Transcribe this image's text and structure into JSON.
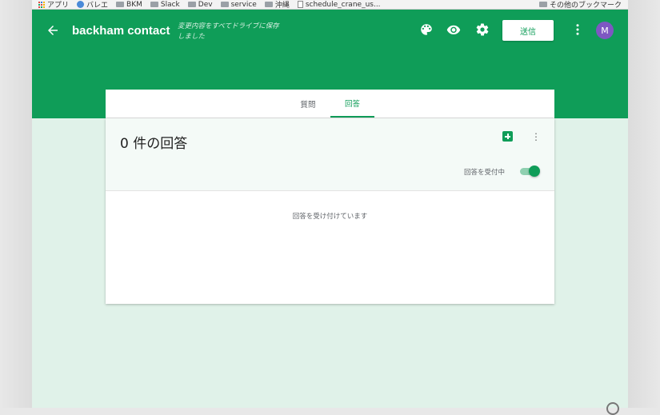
{
  "bookmarks": {
    "items": [
      "アプリ",
      "バレエ",
      "BKM",
      "Slack",
      "Dev",
      "service",
      "沖縄",
      "schedule_crane_us..."
    ],
    "other": "その他のブックマーク"
  },
  "header": {
    "title": "backham contact",
    "save_status": "変更内容をすべてドライブに保存しました",
    "send_label": "送信",
    "avatar_letter": "M",
    "color": "#0f9d58"
  },
  "tabs": {
    "questions": "質問",
    "responses": "回答",
    "active": "回答"
  },
  "responses": {
    "count_label": "0 件の回答",
    "accept_label": "回答を受付中",
    "accepting_message": "回答を受け付けています",
    "accepting_enabled": true
  },
  "icons": [
    "back-arrow-icon",
    "palette-icon",
    "eye-icon",
    "gear-icon",
    "more-vert-icon",
    "sheets-icon"
  ]
}
